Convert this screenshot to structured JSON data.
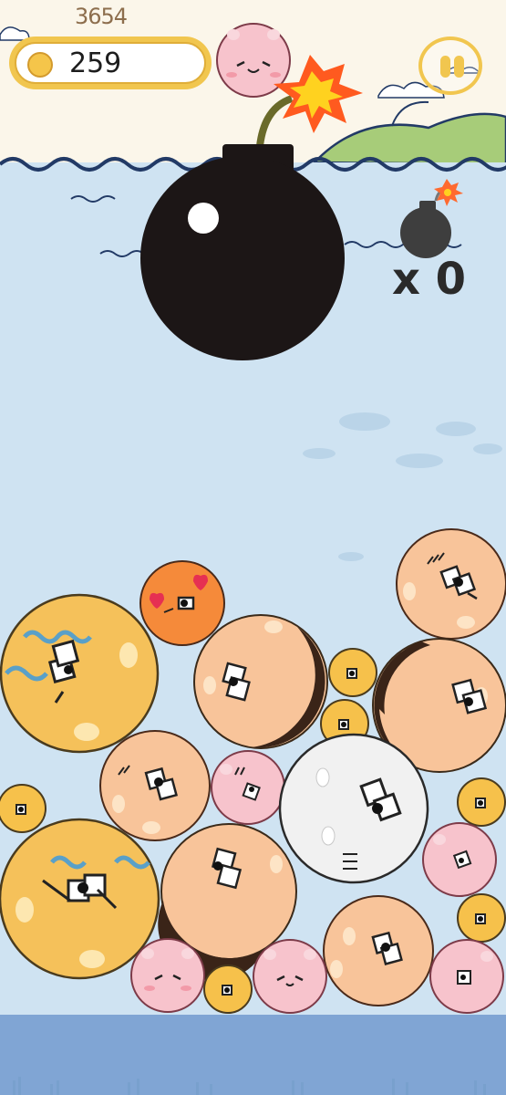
{
  "hud": {
    "best_score": "3654",
    "coins": "259",
    "bomb_count": "x 0"
  },
  "icons": {
    "coin": "coin-icon",
    "pause": "pause-icon",
    "bomb": "bomb-icon"
  },
  "colors": {
    "sky": "#fbf6ea",
    "water": "#cfe3f2",
    "wave_line": "#233a66",
    "hud_yellow": "#f1c64f",
    "ground": "#7ba1d2",
    "bomb": "#1c1616"
  },
  "balls": [
    {
      "kind": "yellow-large",
      "color": "#f5c15a"
    },
    {
      "kind": "orange-hearts",
      "color": "#f58a3a"
    },
    {
      "kind": "peach",
      "color": "#f8c49a"
    },
    {
      "kind": "pink",
      "color": "#f7c3cc"
    },
    {
      "kind": "white",
      "color": "#f1f1f1"
    },
    {
      "kind": "small-yellow",
      "color": "#f6c14b"
    }
  ]
}
